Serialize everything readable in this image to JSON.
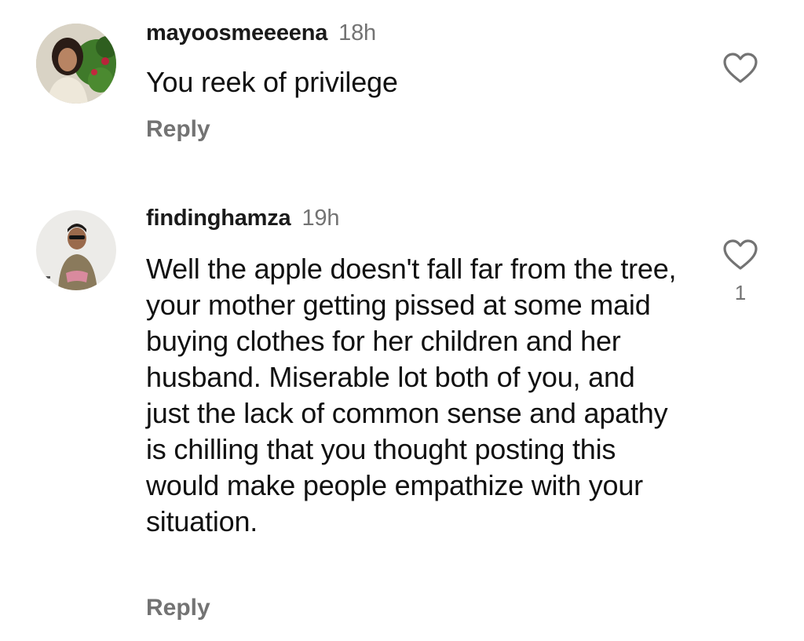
{
  "comments": [
    {
      "username": "mayoosmeeeena",
      "time": "18h",
      "text": "You reek of privilege",
      "reply_label": "Reply",
      "like_count": ""
    },
    {
      "username": "findinghamza",
      "time": "19h",
      "text": "Well the apple doesn't fall far from the tree, your mother getting pissed at some maid buying clothes for her children and her husband. Miserable lot both of you, and just the lack of common sense and apathy is chilling that you thought posting this would make people empathize with your situation.",
      "reply_label": "Reply",
      "like_count": "1"
    }
  ],
  "colors": {
    "text_primary": "#111111",
    "text_secondary": "#737373",
    "background": "#ffffff"
  },
  "icons": {
    "like": "heart-outline-icon"
  }
}
